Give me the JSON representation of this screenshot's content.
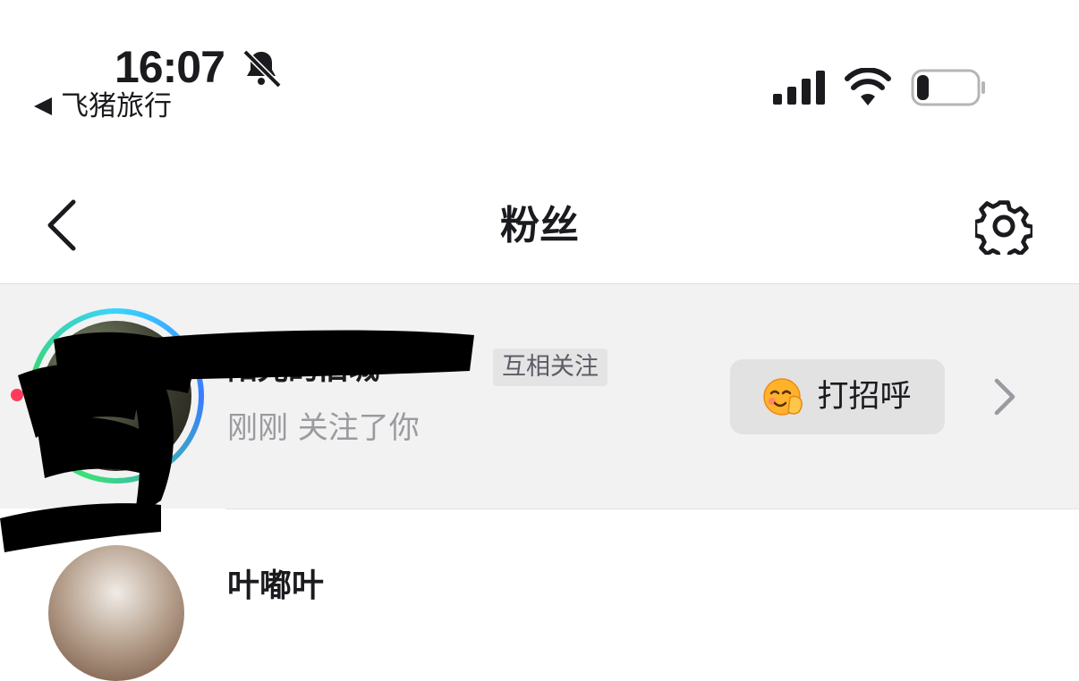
{
  "status_bar": {
    "time": "16:07",
    "back_app": "飞猪旅行",
    "icons": [
      "bell-muted-icon",
      "signal-icon",
      "wifi-icon",
      "battery-icon"
    ],
    "battery_level": 0.2
  },
  "nav": {
    "title": "粉丝",
    "icons": [
      "chevron-left-icon",
      "gear-icon"
    ]
  },
  "followers": [
    {
      "name": "阳光的旧城",
      "badge": "互相关注",
      "subtitle": "刚刚 关注了你",
      "action_label": "打招呼",
      "action_icon": "waving-smile-emoji",
      "trailing_icon": "chevron-right-icon",
      "highlighted": true
    },
    {
      "name": "叶嘟叶"
    }
  ],
  "colors": {
    "row_highlight": "#f2f2f2",
    "badge_bg": "#e4e4e4",
    "subtitle": "#9a9aa0",
    "button_bg": "#e2e2e2",
    "ring_start": "#39d4ff",
    "ring_end": "#3bd55f"
  }
}
